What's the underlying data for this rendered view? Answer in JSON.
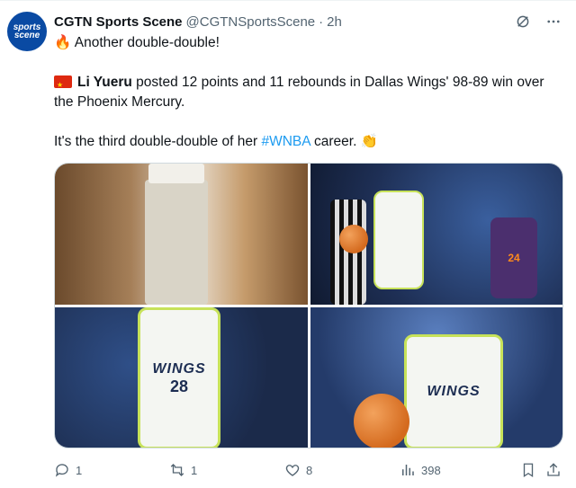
{
  "account": {
    "avatar_line1": "sports",
    "avatar_line2": "scene",
    "name": "CGTN Sports Scene",
    "handle": "@CGTNSportsScene",
    "separator": "·",
    "time": "2h"
  },
  "post": {
    "line1_emoji": "🔥",
    "line1_text": "Another double-double!",
    "player_name": "Li Yueru",
    "p2_rest": " posted 12 points and 11 rebounds in Dallas Wings' 98-89 win over the Phoenix Mercury.",
    "p3_before": "It's the third double-double of her ",
    "hashtag": "#WNBA",
    "p3_after": " career. ",
    "p3_emoji": "👏"
  },
  "media": {
    "jersey_brand": "WINGS",
    "jersey_number": "28",
    "opponent_number": "24"
  },
  "engagement": {
    "replies": "1",
    "reposts": "1",
    "likes": "8",
    "views": "398"
  },
  "colors": {
    "accent": "#1d9bf0",
    "muted": "#536471"
  }
}
